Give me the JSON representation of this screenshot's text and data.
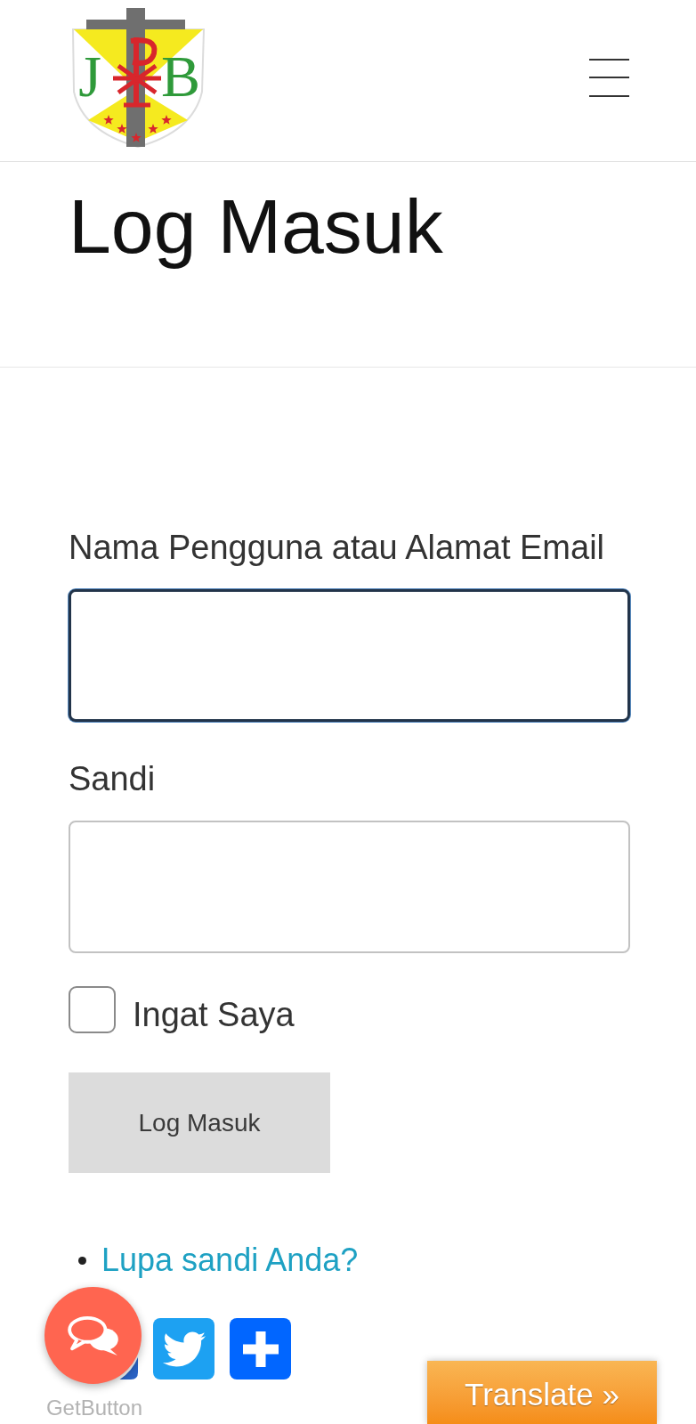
{
  "header": {
    "logo": {
      "letters": [
        "J",
        "B"
      ]
    }
  },
  "page_title": "Log Masuk",
  "form": {
    "fields": [
      {
        "label": "Nama Pengguna atau Alamat Email",
        "focused": true
      },
      {
        "label": "Sandi",
        "focused": false
      }
    ],
    "remember": {
      "label": "Ingat Saya",
      "checked": false
    },
    "submit": "Log Masuk",
    "links": [
      "Lupa sandi Anda?"
    ]
  },
  "share_buttons": [
    {
      "kind": "square"
    },
    {
      "kind": "bird"
    },
    {
      "kind": "plus"
    }
  ],
  "chat_widget": {
    "caption": "GetButton"
  },
  "translate_button": "Translate »"
}
